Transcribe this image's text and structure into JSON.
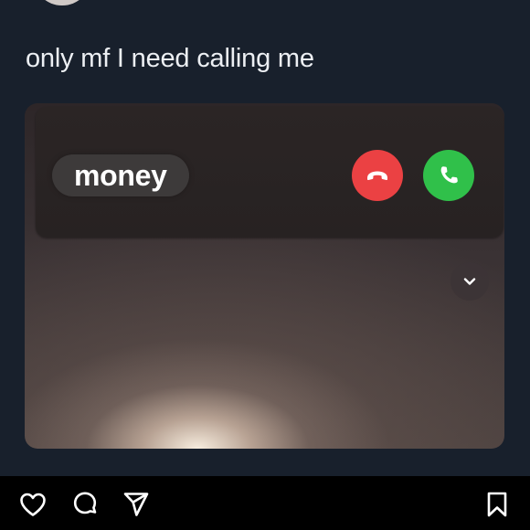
{
  "post": {
    "caption": "only mf I need calling me"
  },
  "incoming_call": {
    "caller_name": "money",
    "decline_color": "#eb4143",
    "accept_color": "#30c04a",
    "decline_icon": "phone-hangup-icon",
    "accept_icon": "phone-icon",
    "expand_icon": "chevron-down-icon"
  },
  "actions": {
    "like_icon": "heart-icon",
    "comment_icon": "comment-icon",
    "share_icon": "paper-plane-icon",
    "save_icon": "bookmark-icon"
  }
}
